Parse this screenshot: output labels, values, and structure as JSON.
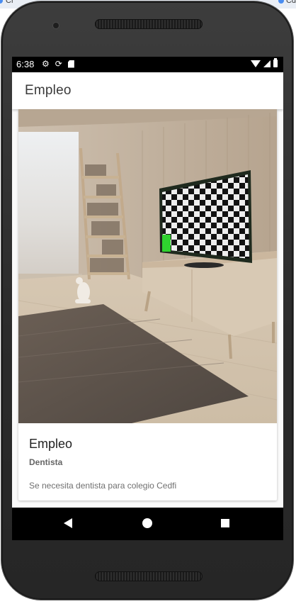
{
  "host": {
    "left_tab_label": "Cr",
    "right_tab_label": "Cd"
  },
  "status_bar": {
    "time": "6:38",
    "left_icons": [
      "settings-icon",
      "sync-icon",
      "sd-card-icon"
    ],
    "right_icons": [
      "wifi-icon",
      "signal-icon",
      "battery-icon"
    ]
  },
  "app_bar": {
    "title": "Empleo"
  },
  "card": {
    "image": "room-with-tv-icon",
    "title": "Empleo",
    "subtitle": "Dentista",
    "description": "Se necesita dentista para colegio Cedfi"
  },
  "nav_bar": {
    "buttons": [
      "back-icon",
      "home-icon",
      "recent-apps-icon"
    ]
  },
  "colors": {
    "phone_body": "#2b2b2b",
    "app_bar": "#ffffff",
    "background": "#fafafa",
    "tv_indicator": "#2fd32f"
  }
}
